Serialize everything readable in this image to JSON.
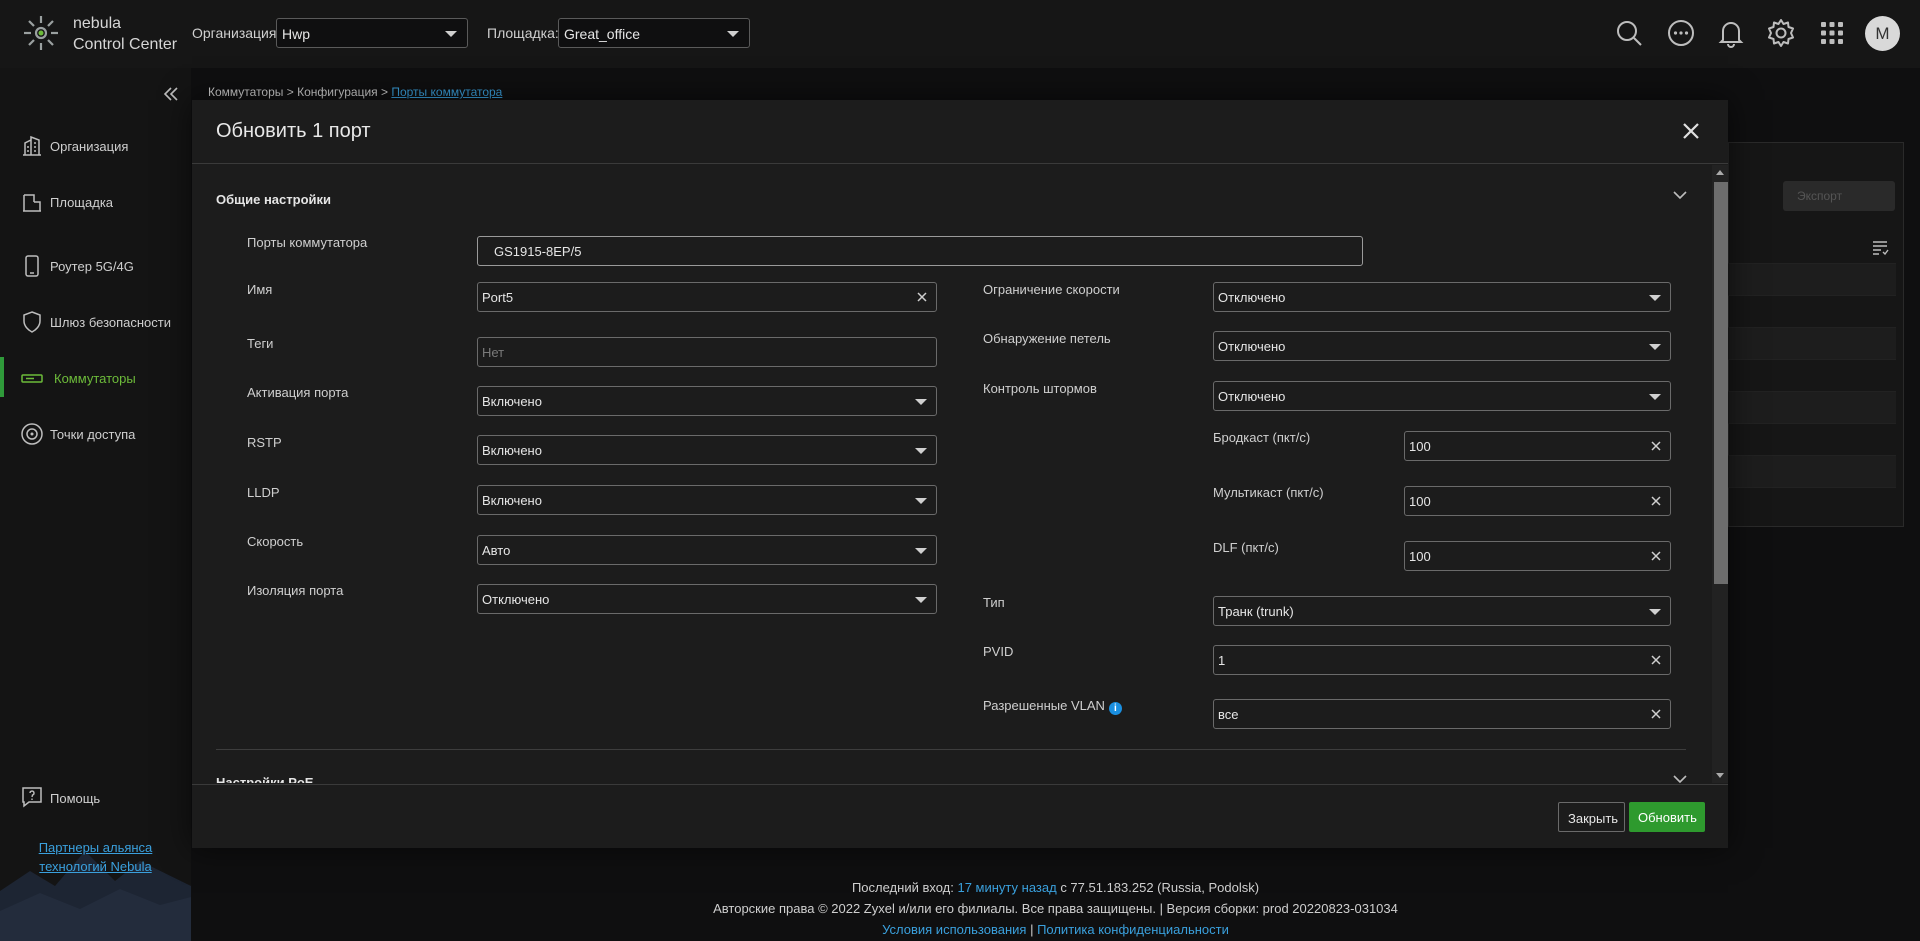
{
  "topbar": {
    "brand_line1": "nebula",
    "brand_line2": "Control Center",
    "org_label": "Организация:",
    "org_value": "Hwp",
    "site_label": "Площадка:",
    "site_value": "Great_office",
    "avatar_letter": "M",
    "icons": [
      "search-icon",
      "chat-icon",
      "bell-icon",
      "gear-icon",
      "apps-grid-icon"
    ]
  },
  "sidebar": {
    "items": [
      {
        "label": "Организация",
        "icon": "building-icon"
      },
      {
        "label": "Площадка",
        "icon": "site-icon"
      },
      {
        "label": "Роутер 5G/4G",
        "icon": "phone-icon"
      },
      {
        "label": "Шлюз безопасности",
        "icon": "shield-icon"
      },
      {
        "label": "Коммутаторы",
        "icon": "switch-icon",
        "active": true
      },
      {
        "label": "Точки доступа",
        "icon": "access-point-icon"
      }
    ],
    "help": "Помощь",
    "partners_line1": "Партнеры альянса",
    "partners_line2": "технологий Nebula"
  },
  "breadcrumb": {
    "part1": "Коммутаторы",
    "part2": "Конфигурация",
    "current": "Порты коммутатора"
  },
  "background": {
    "button_label": "Экспорт"
  },
  "modal": {
    "title": "Обновить 1 порт",
    "section_general": "Общие настройки",
    "section_poe": "Настройки PoE",
    "ports_label": "Порты коммутатора",
    "ports_value": "GS1915-8EP/5",
    "name_label": "Имя",
    "name_value": "Port5",
    "tags_label": "Теги",
    "tags_placeholder": "Нет",
    "port_activation_label": "Активация порта",
    "port_activation_value": "Включено",
    "rstp_label": "RSTP",
    "rstp_value": "Включено",
    "lldp_label": "LLDP",
    "lldp_value": "Включено",
    "speed_label": "Скорость",
    "speed_value": "Авто",
    "isolation_label": "Изоляция порта",
    "isolation_value": "Отключено",
    "rate_limit_label": "Ограничение скорости",
    "rate_limit_value": "Отключено",
    "loop_detect_label": "Обнаружение петель",
    "loop_detect_value": "Отключено",
    "storm_label": "Контроль штормов",
    "storm_value": "Отключено",
    "broadcast_label": "Бродкаст (пкт/с)",
    "broadcast_value": "100",
    "multicast_label": "Мультикаст (пкт/с)",
    "multicast_value": "100",
    "dlf_label": "DLF (пкт/с)",
    "dlf_value": "100",
    "type_label": "Тип",
    "type_value": "Транк (trunk)",
    "pvid_label": "PVID",
    "pvid_value": "1",
    "vlan_label": "Разрешенные VLAN",
    "vlan_value": "все",
    "close_button": "Закрыть",
    "update_button": "Обновить"
  },
  "footer": {
    "last_login_label": "Последний вход:",
    "last_login_link": "17 минуту назад",
    "last_login_from": "с 77.51.183.252 (Russia, Podolsk)",
    "copyright": "Авторские права © 2022 Zyxel и/или его филиалы. Все права защищены. | Версия сборки: prod 20220823-031034",
    "terms": "Условия использования",
    "privacy": "Политика конфиденциальности"
  }
}
